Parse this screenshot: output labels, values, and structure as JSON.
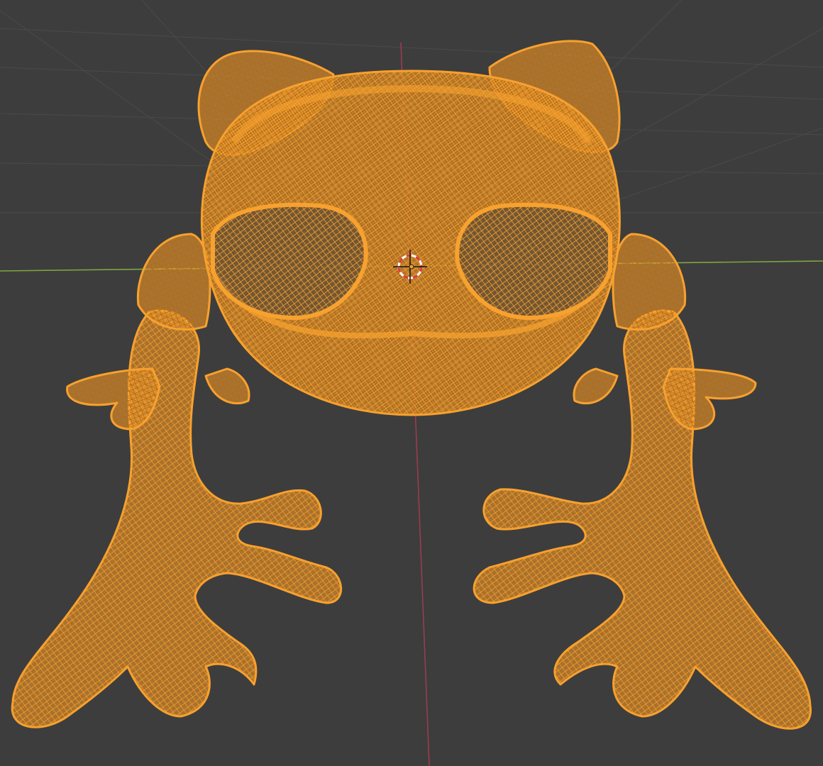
{
  "viewport": {
    "background": "#3d3d3d",
    "grid_color": "#4a4a4a",
    "axis_x_color": "#7ea63f",
    "axis_y_color": "#9c3b52",
    "selected_object_color": "#f7a12f",
    "wire_shade_color": "#c77418",
    "cursor_ring_colors": [
      "#e03a3a",
      "#ffffff"
    ],
    "view_mode": "wireframe"
  },
  "scene": {
    "selected_object": {
      "icon": "wireframe-frog-mesh"
    },
    "cursor": {
      "icon": "3d-cursor-icon"
    },
    "origin": {
      "icon": "object-origin-icon"
    }
  }
}
